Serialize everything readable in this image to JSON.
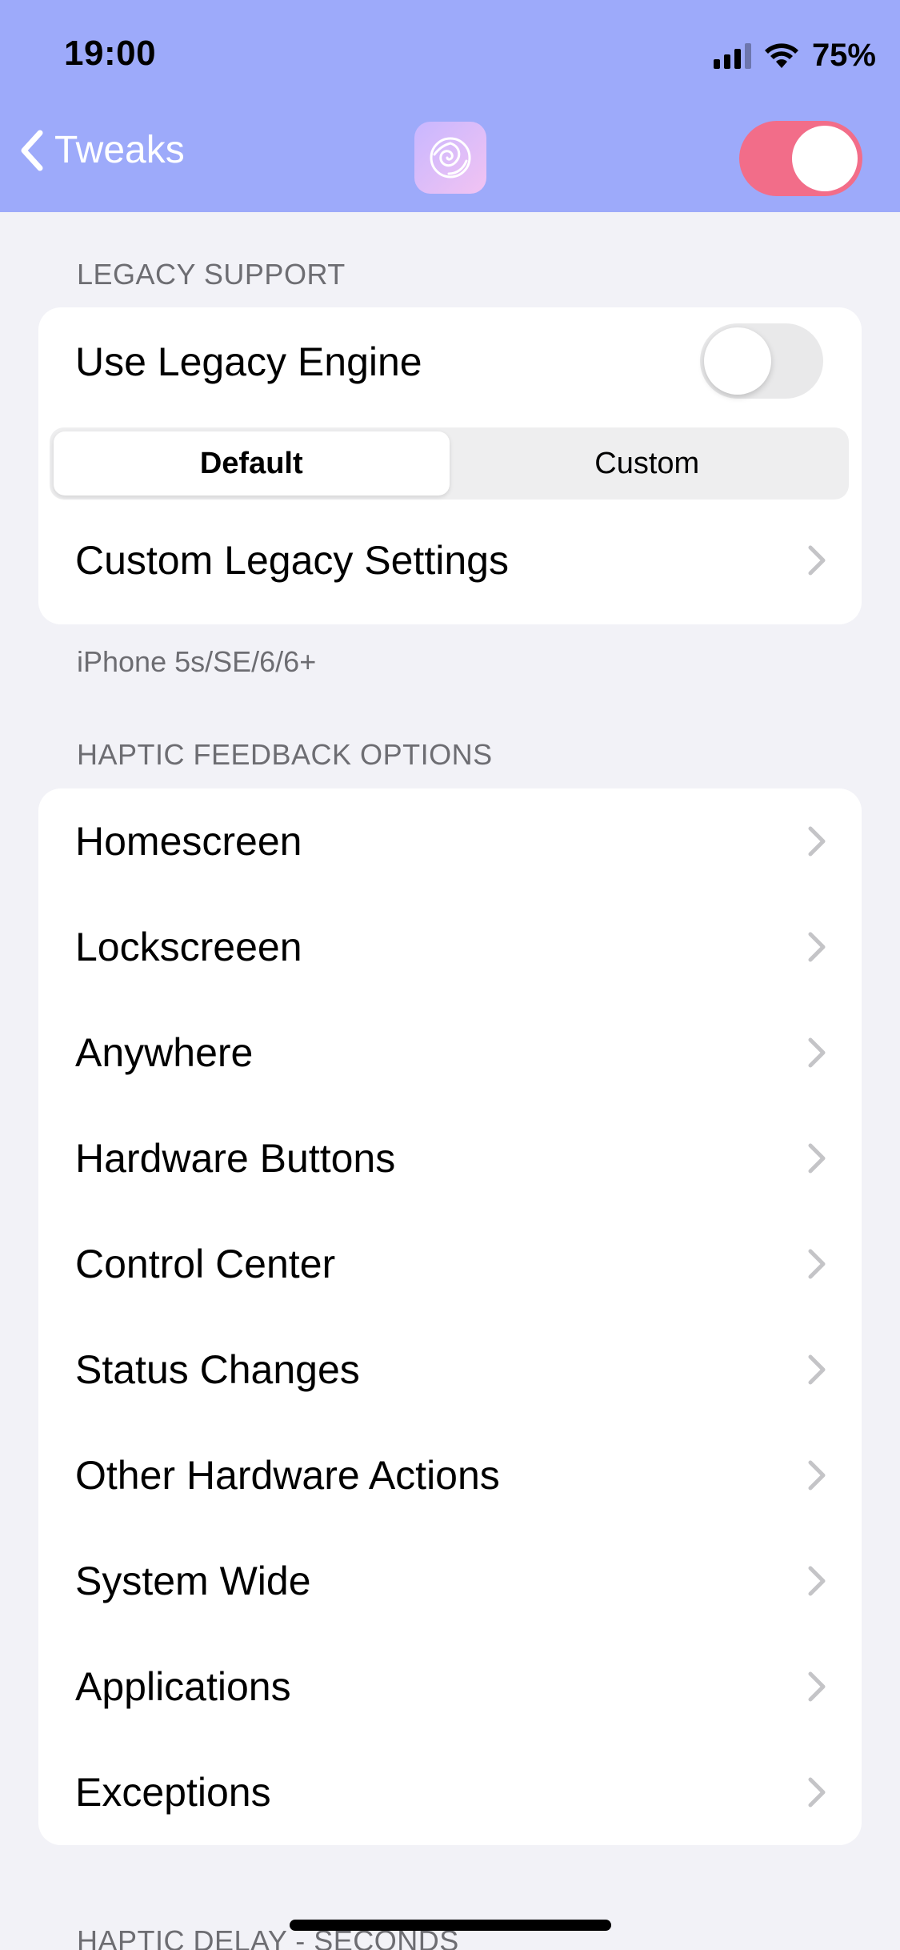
{
  "status_bar": {
    "time": "19:00",
    "battery": "75%"
  },
  "nav": {
    "back_label": "Tweaks",
    "master_enabled": true
  },
  "legacy": {
    "section_title": "LEGACY SUPPORT",
    "use_legacy_label": "Use Legacy Engine",
    "use_legacy_enabled": false,
    "segments": [
      "Default",
      "Custom"
    ],
    "selected_segment": "Default",
    "custom_settings_label": "Custom Legacy Settings",
    "footer": "iPhone 5s/SE/6/6+"
  },
  "haptic": {
    "section_title": "HAPTIC FEEDBACK OPTIONS",
    "items": [
      "Homescreen",
      "Lockscreeen",
      "Anywhere",
      "Hardware Buttons",
      "Control Center",
      "Status Changes",
      "Other Hardware Actions",
      "System Wide",
      "Applications",
      "Exceptions"
    ]
  },
  "next_section_title": "HAPTIC DELAY - SECONDS",
  "colors": {
    "header_bg": "#9daafa",
    "toggle_on": "#f26d89",
    "page_bg": "#f2f2f7"
  }
}
